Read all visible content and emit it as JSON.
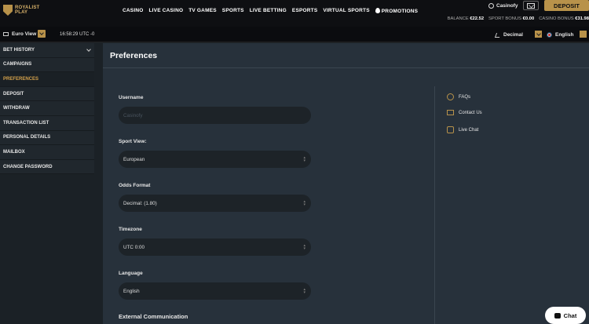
{
  "brand": {
    "name_line1": "ROYALIST",
    "name_line2": "PLAY"
  },
  "nav": [
    "CASINO",
    "LIVE CASINO",
    "TV GAMES",
    "SPORTS",
    "LIVE BETTING",
    "ESPORTS",
    "VIRTUAL SPORTS",
    "PROMOTIONS"
  ],
  "user": {
    "name": "Casinofy",
    "deposit_label": "DEPOSIT"
  },
  "balances": [
    {
      "label": "BALANCE",
      "value": "€22.52"
    },
    {
      "label": "SPORT BONUS",
      "value": "€0.00"
    },
    {
      "label": "CASINO BONUS",
      "value": "€31.98"
    }
  ],
  "subbar": {
    "view": "Euro View",
    "time": "16:58:29 UTC -0",
    "odds": "Decimal",
    "language": "English"
  },
  "sidebar": [
    {
      "label": "BET HISTORY"
    },
    {
      "label": "CAMPAIGNS"
    },
    {
      "label": "PREFERENCES"
    },
    {
      "label": "DEPOSIT"
    },
    {
      "label": "WITHDRAW"
    },
    {
      "label": "TRANSACTION LIST"
    },
    {
      "label": "PERSONAL DETAILS"
    },
    {
      "label": "MAILBOX"
    },
    {
      "label": "CHANGE PASSWORD"
    }
  ],
  "main": {
    "title": "Preferences",
    "fields": [
      {
        "label": "Username",
        "value": "Casinofy"
      },
      {
        "label": "Sport View:",
        "value": "European"
      },
      {
        "label": "Odds Format",
        "value": "Decimal: (1.80)"
      },
      {
        "label": "Timezone",
        "value": "UTC 0:00"
      },
      {
        "label": "Language",
        "value": "English"
      }
    ],
    "external": "External Communication"
  },
  "help": [
    "FAQs",
    "Contact Us",
    "Live Chat"
  ],
  "chat_label": "Chat",
  "colors": {
    "accent": "#b8924a",
    "active": "#d2a04a",
    "panel": "#27313b"
  }
}
